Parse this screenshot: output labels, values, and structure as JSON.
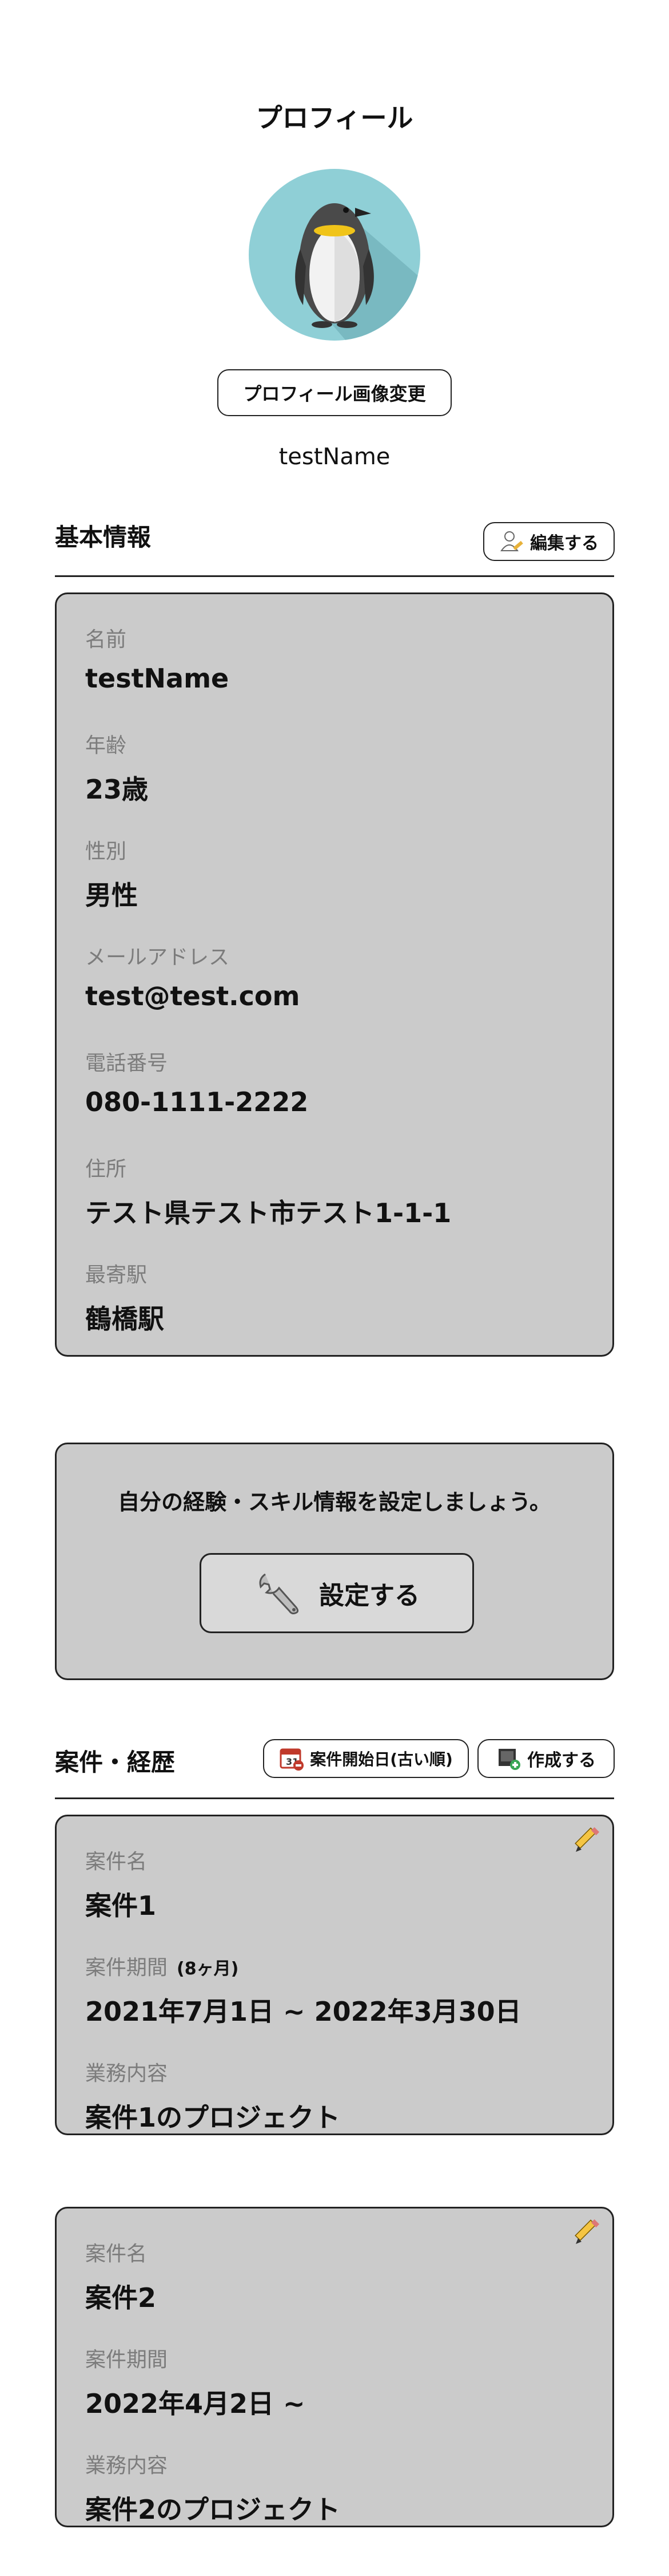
{
  "page_title": "プロフィール",
  "avatar": {
    "icon": "penguin-avatar"
  },
  "change_image_button": "プロフィール画像変更",
  "user_name": "testName",
  "basic_info": {
    "title": "基本情報",
    "edit_button": "編集する",
    "fields": [
      {
        "label": "名前",
        "value": "testName"
      },
      {
        "label": "年齢",
        "value": "23歳"
      },
      {
        "label": "性別",
        "value": "男性"
      },
      {
        "label": "メールアドレス",
        "value": "test@test.com"
      },
      {
        "label": "電話番号",
        "value": "080-1111-2222"
      },
      {
        "label": "住所",
        "value": "テスト県テスト市テスト1-1-1"
      },
      {
        "label": "最寄駅",
        "value": "鶴橋駅"
      }
    ]
  },
  "skills": {
    "message": "自分の経験・スキル情報を設定しましょう。",
    "button": "設定する"
  },
  "projects": {
    "title": "案件・経歴",
    "sort_button": "案件開始日(古い順)",
    "create_button": "作成する",
    "items": [
      {
        "name_label": "案件名",
        "name": "案件1",
        "period_label": "案件期間",
        "period_note": "(8ヶ月)",
        "period": "2021年7月1日 ~ 2022年3月30日",
        "content_label": "業務内容",
        "content": "案件1のプロジェクト"
      },
      {
        "name_label": "案件名",
        "name": "案件2",
        "period_label": "案件期間",
        "period_note": "",
        "period": "2022年4月2日 ~",
        "content_label": "業務内容",
        "content": "案件2のプロジェクト"
      }
    ]
  },
  "colors": {
    "card_bg": "#cbcbcb",
    "avatar_bg": "#8fcfd6",
    "label_gray": "#7c7c7c"
  }
}
